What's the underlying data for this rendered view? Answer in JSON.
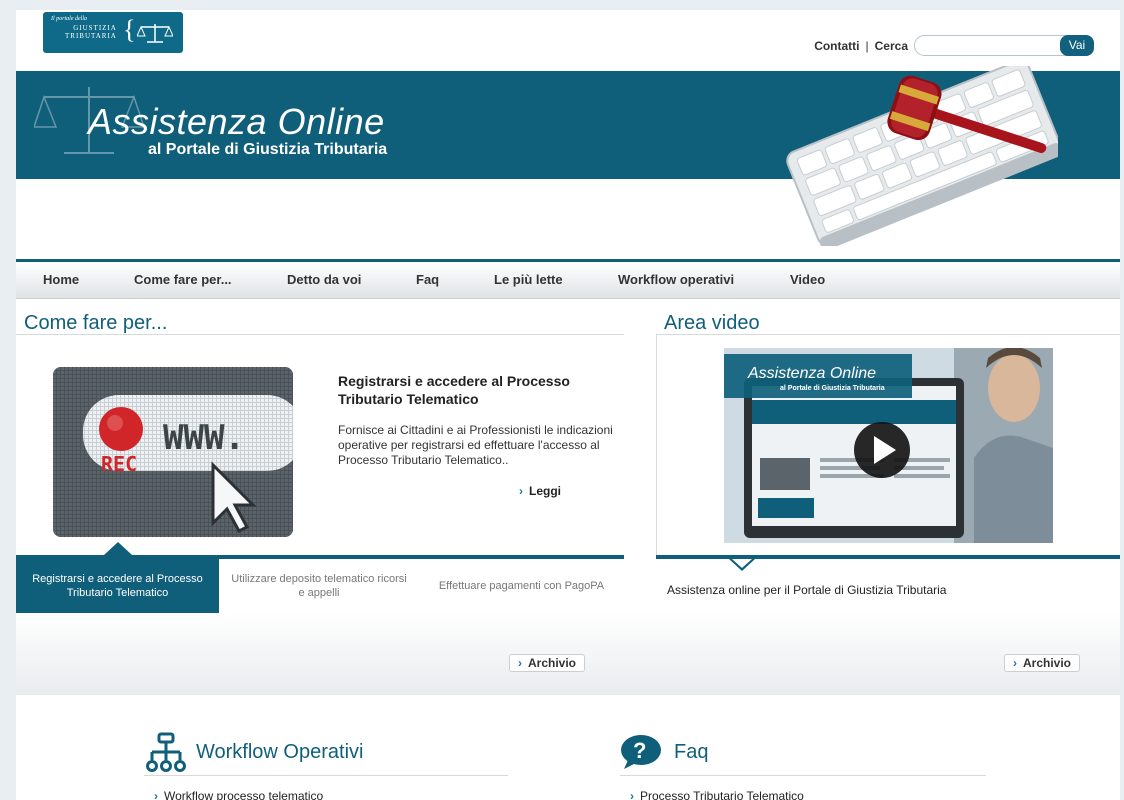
{
  "header": {
    "logo_small": "Il portale della",
    "logo_line1": "GIUSTIZIA",
    "logo_line2": "TRIBUTARIA",
    "contatti": "Contatti",
    "separator": "|",
    "cerca": "Cerca",
    "search_placeholder": "",
    "search_button": "Vai"
  },
  "banner": {
    "title": "Assistenza Online",
    "subtitle": "al Portale di Giustizia Tributaria"
  },
  "nav": {
    "items": [
      "Home",
      "Come fare per...",
      "Detto da voi",
      "Faq",
      "Le più lette",
      "Workflow operativi",
      "Video"
    ]
  },
  "come_fare": {
    "section_title": "Come fare per...",
    "thumb_text_www": "WWW.",
    "thumb_text_rec": "REC",
    "article_title": "Registrarsi e accedere al Processo Tributario Telematico",
    "article_desc": "Fornisce ai Cittadini e ai Professionisti le indicazioni operative per registrarsi ed effettuare l'accesso al Processo Tributario Telematico..",
    "read_more": "Leggi",
    "tabs": [
      "Registrarsi e accedere al Processo Tributario Telematico",
      "Utilizzare deposito telematico ricorsi e appelli",
      "Effettuare pagamenti con PagoPA"
    ],
    "archive": "Archivio"
  },
  "video": {
    "section_title": "Area video",
    "overlay_title": "Assistenza Online",
    "overlay_sub": "al Portale di Giustizia Tributaria",
    "caption": "Assistenza online per il Portale di Giustizia Tributaria",
    "archive": "Archivio"
  },
  "bottom": {
    "workflow_title": "Workflow Operativi",
    "workflow_link": "Workflow processo telematico",
    "faq_title": "Faq",
    "faq_link": "Processo Tributario Telematico"
  },
  "colors": {
    "brand": "#0f5f7b",
    "accent": "#1e7a99"
  }
}
